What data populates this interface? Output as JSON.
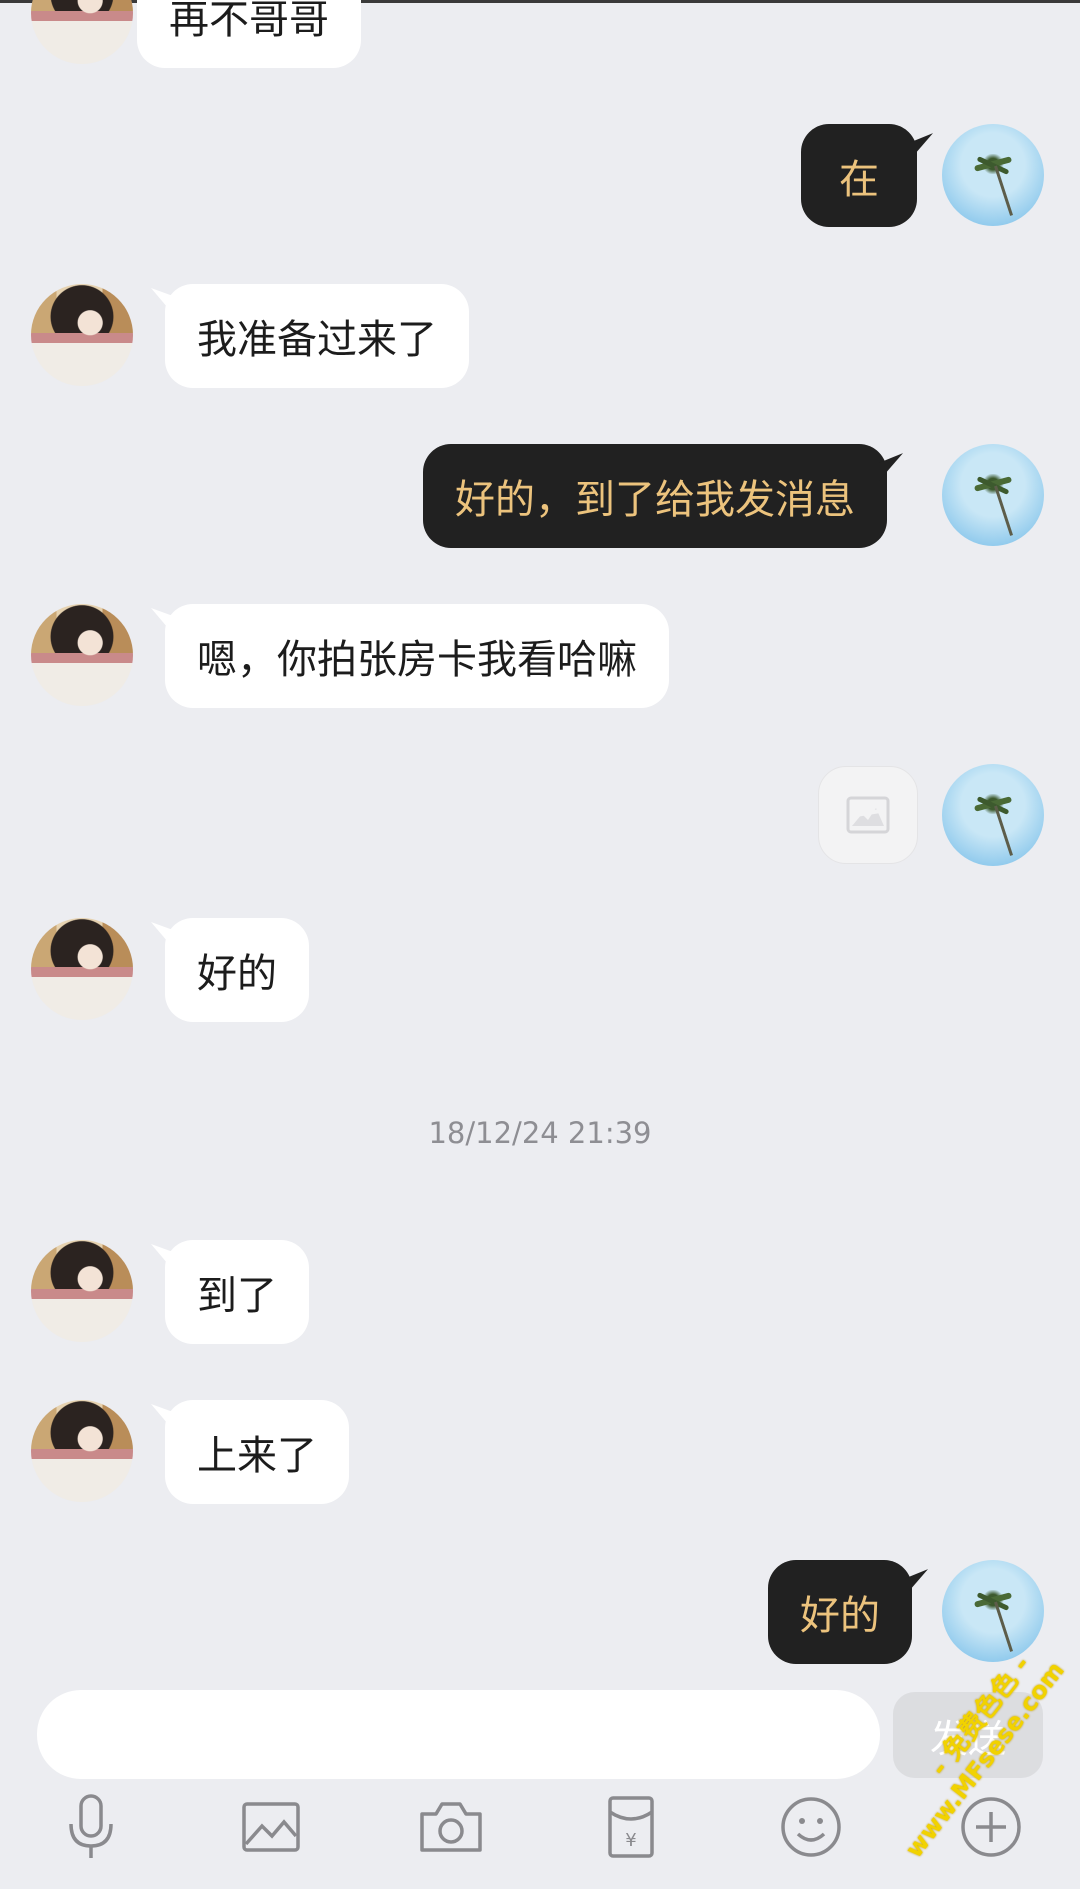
{
  "messages": [
    {
      "side": "left",
      "text": "再不哥哥"
    },
    {
      "side": "right",
      "text": "在"
    },
    {
      "side": "left",
      "text": "我准备过来了"
    },
    {
      "side": "right",
      "text": "好的，到了给我发消息"
    },
    {
      "side": "left",
      "text": "嗯，你拍张房卡我看哈嘛"
    },
    {
      "side": "right",
      "type": "image"
    },
    {
      "side": "left",
      "text": "好的"
    },
    {
      "side": "left",
      "text": "到了"
    },
    {
      "side": "left",
      "text": "上来了"
    },
    {
      "side": "right",
      "text": "好的"
    }
  ],
  "timestamp": "18/12/24 21:39",
  "input": {
    "value": "",
    "placeholder": ""
  },
  "send_button": {
    "label": "发送"
  },
  "toolbar": {
    "icons": [
      "microphone-icon",
      "image-icon",
      "camera-icon",
      "red-packet-icon",
      "emoji-icon",
      "plus-icon"
    ]
  },
  "watermark": {
    "line1": "- 免费色色 -",
    "line2": "www.MFsese.com"
  },
  "colors": {
    "background": "#ecedf1",
    "incoming_bubble": "#ffffff",
    "outgoing_bubble": "#212121",
    "outgoing_text": "#ecc37d"
  }
}
